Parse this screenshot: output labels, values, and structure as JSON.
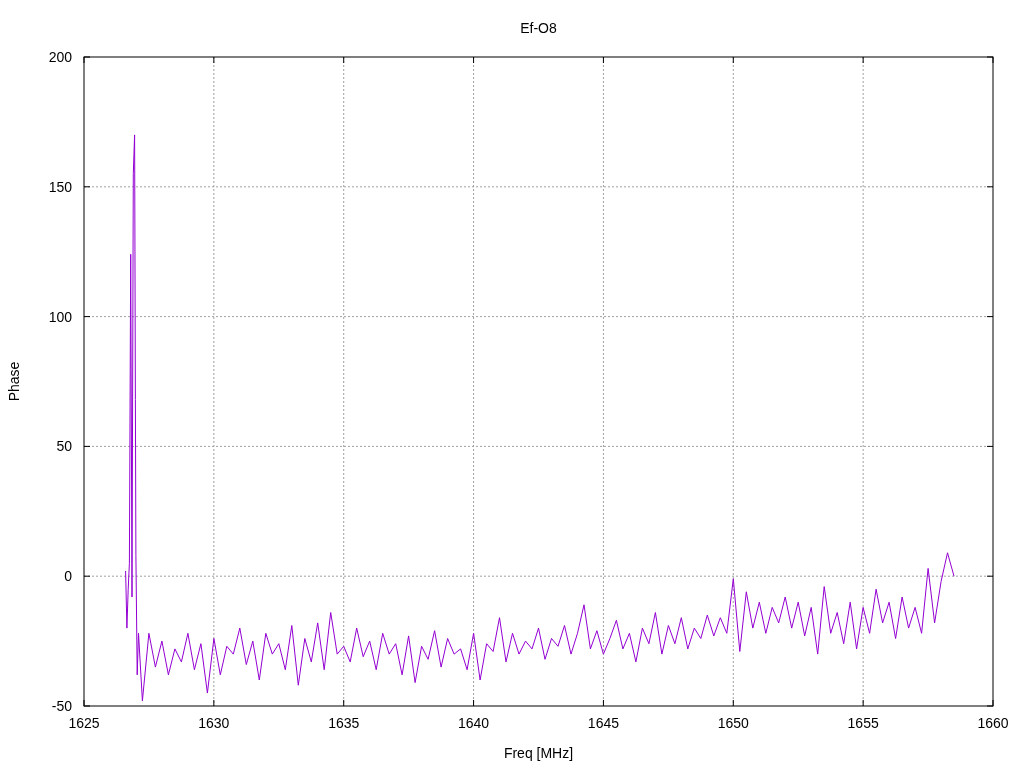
{
  "chart_data": {
    "type": "line",
    "grid": true,
    "title": "Ef-O8",
    "xlabel": "Freq [MHz]",
    "ylabel": "Phase",
    "xlim": [
      1625,
      1660
    ],
    "ylim": [
      -50,
      200
    ],
    "xticks": [
      1625,
      1630,
      1635,
      1640,
      1645,
      1650,
      1655,
      1660
    ],
    "yticks": [
      -50,
      0,
      50,
      100,
      150,
      200
    ],
    "x": [
      1626.6,
      1626.65,
      1626.7,
      1626.75,
      1626.8,
      1626.85,
      1626.9,
      1626.95,
      1626.98,
      1627.0,
      1627.05,
      1627.1,
      1627.25,
      1627.5,
      1627.75,
      1628,
      1628.25,
      1628.5,
      1628.75,
      1629,
      1629.25,
      1629.5,
      1629.75,
      1630,
      1630.25,
      1630.5,
      1630.75,
      1631,
      1631.25,
      1631.5,
      1631.75,
      1632,
      1632.25,
      1632.5,
      1632.75,
      1633,
      1633.25,
      1633.5,
      1633.75,
      1634,
      1634.25,
      1634.5,
      1634.75,
      1635,
      1635.25,
      1635.5,
      1635.75,
      1636,
      1636.25,
      1636.5,
      1636.75,
      1637,
      1637.25,
      1637.5,
      1637.75,
      1638,
      1638.25,
      1638.5,
      1638.75,
      1639,
      1639.25,
      1639.5,
      1639.75,
      1640,
      1640.25,
      1640.5,
      1640.75,
      1641,
      1641.25,
      1641.5,
      1641.75,
      1642,
      1642.25,
      1642.5,
      1642.75,
      1643,
      1643.25,
      1643.5,
      1643.75,
      1644,
      1644.25,
      1644.5,
      1644.75,
      1645,
      1645.25,
      1645.5,
      1645.75,
      1646,
      1646.25,
      1646.5,
      1646.75,
      1647,
      1647.25,
      1647.5,
      1647.75,
      1648,
      1648.25,
      1648.5,
      1648.75,
      1649,
      1649.25,
      1649.5,
      1649.75,
      1650,
      1650.25,
      1650.5,
      1650.75,
      1651,
      1651.25,
      1651.5,
      1651.75,
      1652,
      1652.25,
      1652.5,
      1652.75,
      1653,
      1653.25,
      1653.5,
      1653.75,
      1654,
      1654.25,
      1654.5,
      1654.75,
      1655,
      1655.25,
      1655.5,
      1655.75,
      1656,
      1656.25,
      1656.5,
      1656.75,
      1657,
      1657.25,
      1657.5,
      1657.75,
      1658,
      1658.25,
      1658.5
    ],
    "series": [
      {
        "color": "#9400d3",
        "values": [
          2,
          -20,
          -5,
          5,
          124,
          -8,
          155,
          170,
          68,
          8,
          -38,
          -22,
          -48,
          -22,
          -35,
          -25,
          -38,
          -28,
          -33,
          -22,
          -36,
          -26,
          -45,
          -24,
          -38,
          -27,
          -30,
          -20,
          -34,
          -25,
          -40,
          -22,
          -30,
          -26,
          -36,
          -19,
          -42,
          -24,
          -33,
          -18,
          -36,
          -14,
          -30,
          -27,
          -33,
          -20,
          -31,
          -25,
          -36,
          -22,
          -30,
          -26,
          -38,
          -23,
          -41,
          -27,
          -32,
          -21,
          -35,
          -24,
          -30,
          -28,
          -36,
          -22,
          -40,
          -26,
          -29,
          -16,
          -33,
          -22,
          -30,
          -25,
          -28,
          -20,
          -32,
          -24,
          -27,
          -19,
          -30,
          -22,
          -11,
          -28,
          -21,
          -30,
          -24,
          -17,
          -28,
          -22,
          -33,
          -20,
          -26,
          -14,
          -30,
          -19,
          -26,
          -16,
          -28,
          -20,
          -24,
          -15,
          -23,
          -16,
          -22,
          -1,
          -29,
          -6,
          -20,
          -10,
          -22,
          -12,
          -18,
          -8,
          -20,
          -10,
          -23,
          -12,
          -30,
          -4,
          -22,
          -14,
          -26,
          -10,
          -28,
          -12,
          -22,
          -5,
          -18,
          -10,
          -24,
          -8,
          -20,
          -12,
          -22,
          3,
          -18,
          -2,
          9,
          0
        ]
      }
    ]
  }
}
